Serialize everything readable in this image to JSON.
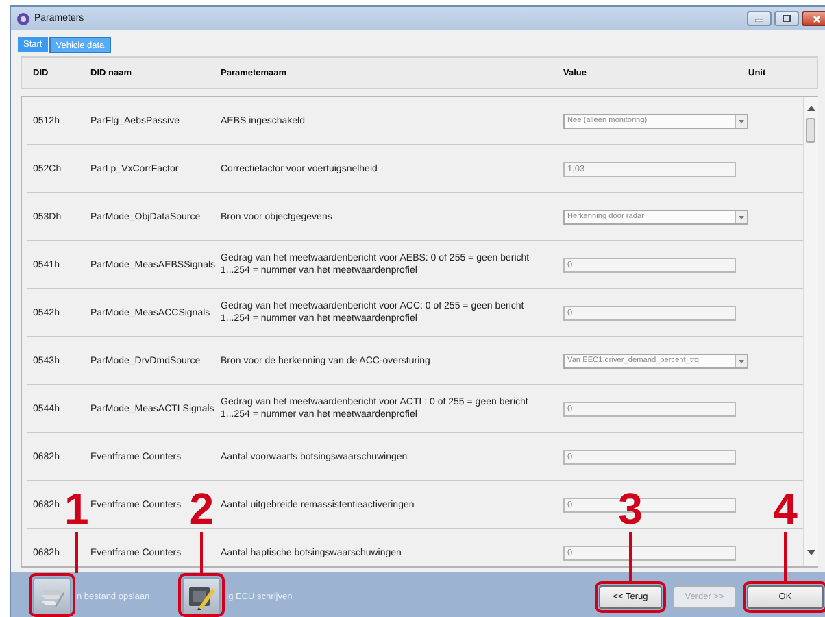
{
  "window": {
    "title": "Parameters"
  },
  "tabs": [
    {
      "label": "Start",
      "selected": false
    },
    {
      "label": "Vehicle data",
      "selected": true
    }
  ],
  "table": {
    "columns": [
      "DID",
      "DID naam",
      "Parametemaam",
      "Value",
      "Unit"
    ],
    "rows": [
      {
        "did": "0512h",
        "did_name": "ParFlg_AebsPassive",
        "parameter": "AEBS ingeschakeld",
        "value": {
          "kind": "dropdown",
          "text": "Nee (alleen monitoring)"
        }
      },
      {
        "did": "052Ch",
        "did_name": "ParLp_VxCorrFactor",
        "parameter": "Correctiefactor voor voertuigsnelheid",
        "value": {
          "kind": "field",
          "text": "1,03"
        }
      },
      {
        "did": "053Dh",
        "did_name": "ParMode_ObjDataSource",
        "parameter": "Bron voor objectgegevens",
        "value": {
          "kind": "dropdown",
          "text": "Herkenning door radar"
        }
      },
      {
        "did": "0541h",
        "did_name": "ParMode_MeasAEBSSignals",
        "parameter": "Gedrag van het meetwaardenbericht voor AEBS: 0 of 255 = geen bericht 1...254 = nummer van het meetwaardenprofiel",
        "value": {
          "kind": "field",
          "text": "0"
        }
      },
      {
        "did": "0542h",
        "did_name": "ParMode_MeasACCSignals",
        "parameter": "Gedrag van het meetwaardenbericht voor ACC: 0 of 255 = geen bericht 1...254 = nummer van het meetwaardenprofiel",
        "value": {
          "kind": "field",
          "text": "0"
        }
      },
      {
        "did": "0543h",
        "did_name": "ParMode_DrvDmdSource",
        "parameter": "Bron voor de herkenning van de ACC-oversturing",
        "value": {
          "kind": "dropdown",
          "text": "Van EEC1.driver_demand_percent_trq"
        }
      },
      {
        "did": "0544h",
        "did_name": "ParMode_MeasACTLSignals",
        "parameter": "Gedrag van het meetwaardenbericht voor ACTL: 0 of 255 = geen bericht 1...254 = nummer van het meetwaardenprofiel",
        "value": {
          "kind": "field",
          "text": "0"
        }
      },
      {
        "did": "0682h",
        "did_name": "Eventframe Counters",
        "parameter": "Aantal voorwaarts botsingswaarschuwingen",
        "value": {
          "kind": "field",
          "text": "0"
        }
      },
      {
        "did": "0682h",
        "did_name": "Eventframe Counters",
        "parameter": "Aantal uitgebreide remassistentieactiveringen",
        "value": {
          "kind": "field",
          "text": "0"
        }
      },
      {
        "did": "0682h",
        "did_name": "Eventframe Counters",
        "parameter": "Aantal haptische botsingswaarschuwingen",
        "value": {
          "kind": "field",
          "text": "0"
        }
      }
    ]
  },
  "footer": {
    "actions": [
      {
        "kind": "file",
        "label": "n bestand opslaan"
      },
      {
        "kind": "ecu",
        "label": "ig ECU schrijven"
      }
    ],
    "buttons": [
      {
        "label": "<< Terug",
        "disabled": false
      },
      {
        "label": "Verder >>",
        "disabled": true
      },
      {
        "label": "OK",
        "disabled": false
      }
    ]
  },
  "callouts": [
    {
      "label": "1"
    },
    {
      "label": "2"
    },
    {
      "label": "3"
    },
    {
      "label": "4"
    }
  ]
}
